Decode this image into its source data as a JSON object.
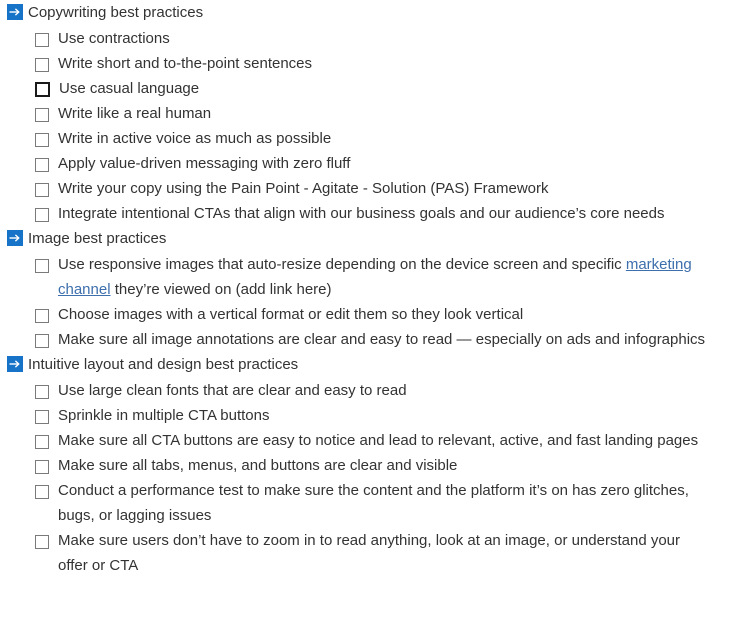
{
  "document": {
    "type": "checklist",
    "accent_color": "#1673c8",
    "text_color": "#333333",
    "link_color": "#3d6fad",
    "sections": [
      {
        "icon": "arrow-right-icon",
        "title": "Copywriting best practices",
        "items": [
          {
            "checked": false,
            "focused": false,
            "text": "Use contractions"
          },
          {
            "checked": false,
            "focused": false,
            "text": "Write short and to-the-point sentences"
          },
          {
            "checked": false,
            "focused": true,
            "text": "Use casual language"
          },
          {
            "checked": false,
            "focused": false,
            "text": "Write like a real human"
          },
          {
            "checked": false,
            "focused": false,
            "text": "Write in active voice as much as possible"
          },
          {
            "checked": false,
            "focused": false,
            "text": "Apply value-driven messaging with zero fluff"
          },
          {
            "checked": false,
            "focused": false,
            "text": "Write your copy using the Pain Point - Agitate - Solution (PAS) Framework"
          },
          {
            "checked": false,
            "focused": false,
            "text": "Integrate intentional CTAs that align with our business goals and our audience’s core needs"
          }
        ]
      },
      {
        "icon": "arrow-right-icon",
        "title": "Image best practices",
        "items": [
          {
            "checked": false,
            "focused": false,
            "text_before_link": "Use responsive images that auto-resize depending on the device screen and specific ",
            "link_text": "marketing channel",
            "text_after_link": " they’re viewed on (add link here)"
          },
          {
            "checked": false,
            "focused": false,
            "text": "Choose images with a vertical format or edit them so they look vertical"
          },
          {
            "checked": false,
            "focused": false,
            "text": "Make sure all image annotations are clear and easy to read — especially on ads and infographics"
          }
        ]
      },
      {
        "icon": "arrow-right-icon",
        "title": "Intuitive layout and design best practices",
        "items": [
          {
            "checked": false,
            "focused": false,
            "text": "Use large clean fonts that are clear and easy to read"
          },
          {
            "checked": false,
            "focused": false,
            "text": "Sprinkle in multiple CTA buttons"
          },
          {
            "checked": false,
            "focused": false,
            "text": "Make sure all CTA buttons are easy to notice and lead to relevant, active, and fast landing pages"
          },
          {
            "checked": false,
            "focused": false,
            "text": "Make sure all tabs, menus, and buttons are clear and visible"
          },
          {
            "checked": false,
            "focused": false,
            "text": "Conduct a performance test to make sure the content and the platform it’s on has zero glitches, bugs, or lagging issues"
          },
          {
            "checked": false,
            "focused": false,
            "text": "Make sure users don’t have to zoom in to read anything, look at an image, or understand your offer or CTA"
          }
        ]
      }
    ]
  }
}
